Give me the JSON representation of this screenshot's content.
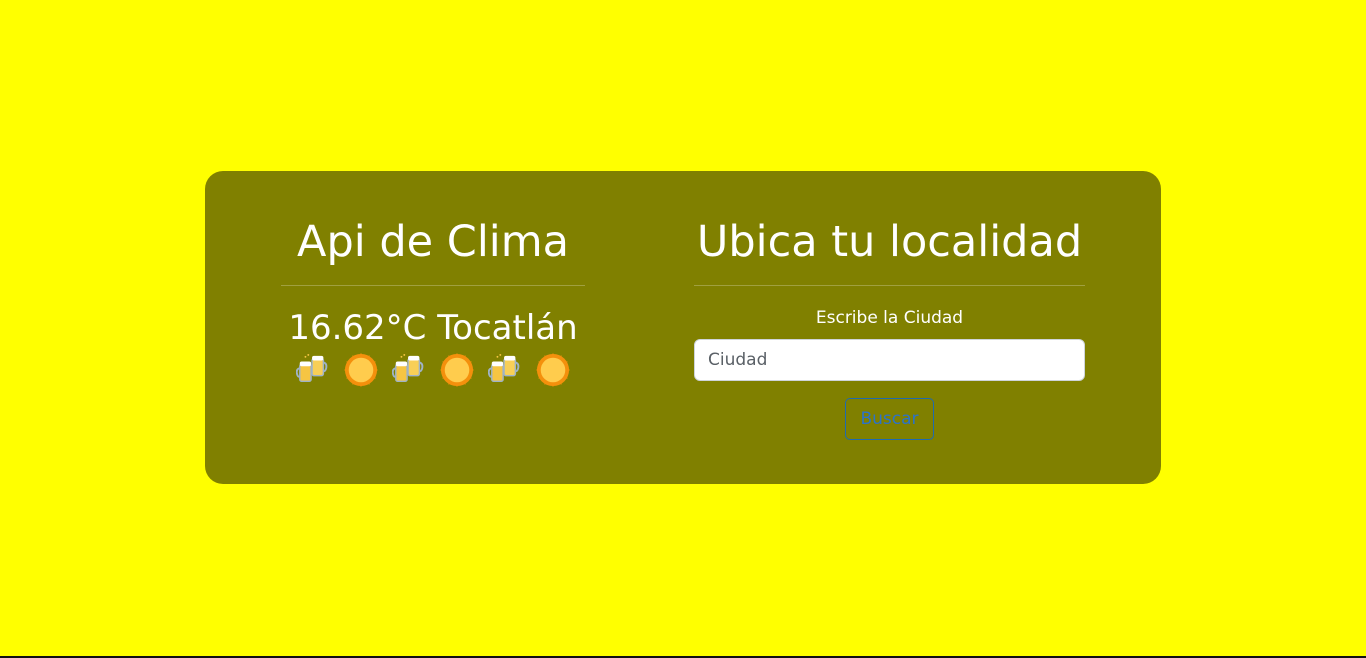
{
  "weather": {
    "title": "Api de Clima",
    "temperature_line": "16.62°C Tocatlán",
    "icons": [
      "beer-mugs-icon",
      "sun-icon",
      "beer-mugs-icon",
      "sun-icon",
      "beer-mugs-icon",
      "sun-icon"
    ]
  },
  "locator": {
    "title": "Ubica tu localidad",
    "label": "Escribe la Ciudad",
    "input_placeholder": "Ciudad",
    "input_value": "",
    "button_label": "Buscar"
  },
  "colors": {
    "page_background": "#ffff00",
    "card_background": "#808000",
    "button_accent": "#0d6efd"
  }
}
